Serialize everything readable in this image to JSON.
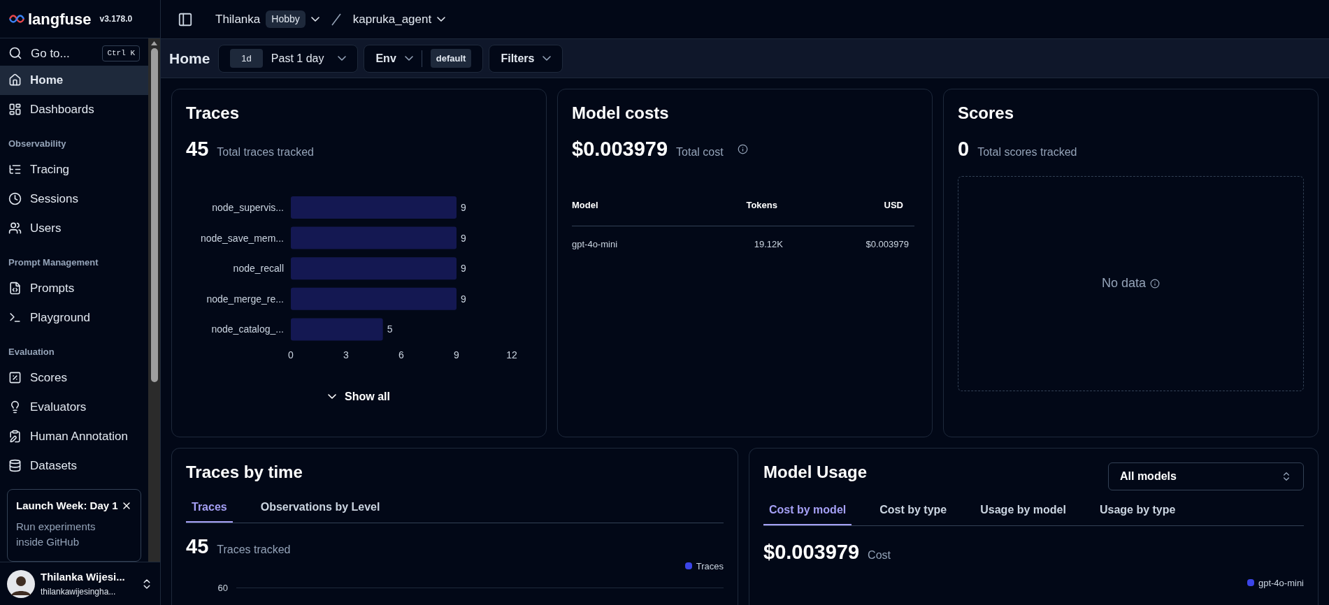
{
  "sidebar": {
    "brand": "langfuse",
    "version": "v3.178.0",
    "goto": {
      "label": "Go to...",
      "shortcut": "Ctrl K"
    },
    "sections": [
      {
        "items": [
          {
            "label": "Home",
            "selected": true
          },
          {
            "label": "Dashboards",
            "selected": false
          }
        ]
      },
      {
        "heading": "Observability",
        "items": [
          {
            "label": "Tracing",
            "selected": false
          },
          {
            "label": "Sessions",
            "selected": false
          },
          {
            "label": "Users",
            "selected": false
          }
        ]
      },
      {
        "heading": "Prompt Management",
        "items": [
          {
            "label": "Prompts",
            "selected": false
          },
          {
            "label": "Playground",
            "selected": false
          }
        ]
      },
      {
        "heading": "Evaluation",
        "items": [
          {
            "label": "Scores",
            "selected": false
          },
          {
            "label": "Evaluators",
            "selected": false
          },
          {
            "label": "Human Annotation",
            "selected": false
          },
          {
            "label": "Datasets",
            "selected": false
          }
        ]
      }
    ],
    "promo": {
      "title": "Launch Week: Day 1",
      "text": "Run experiments inside GitHub"
    },
    "user": {
      "name": "Thilanka Wijesi...",
      "email": "thilankawijesingha..."
    }
  },
  "topbar": {
    "org": "Thilanka",
    "plan": "Hobby",
    "project": "kapruka_agent"
  },
  "filterbar": {
    "title": "Home",
    "range_badge": "1d",
    "range": "Past 1 day",
    "env_label": "Env",
    "env_value": "default",
    "filters": "Filters"
  },
  "traces_card": {
    "title": "Traces",
    "total": "45",
    "total_label": "Total traces tracked",
    "show_all": "Show all",
    "chart_data": {
      "type": "bar",
      "orientation": "horizontal",
      "categories": [
        "node_supervis...",
        "node_save_mem...",
        "node_recall",
        "node_merge_re...",
        "node_catalog_..."
      ],
      "values": [
        9,
        9,
        9,
        9,
        5
      ],
      "xticks": [
        0,
        3,
        6,
        9,
        12
      ],
      "xlim": [
        0,
        12
      ],
      "data_labels": true
    }
  },
  "costs_card": {
    "title": "Model costs",
    "total": "$0.003979",
    "total_label": "Total cost",
    "columns": [
      "Model",
      "Tokens",
      "USD"
    ],
    "rows": [
      [
        "gpt-4o-mini",
        "19.12K",
        "$0.003979"
      ]
    ]
  },
  "scores_card": {
    "title": "Scores",
    "total": "0",
    "total_label": "Total scores tracked",
    "empty": "No data"
  },
  "time_card": {
    "title": "Traces by time",
    "tabs": [
      {
        "label": "Traces",
        "selected": true
      },
      {
        "label": "Observations by Level",
        "selected": false
      }
    ],
    "total": "45",
    "total_label": "Traces tracked",
    "legend": "Traces",
    "ytick": "60"
  },
  "usage_card": {
    "title": "Model Usage",
    "select": "All models",
    "tabs": [
      {
        "label": "Cost by model",
        "selected": true
      },
      {
        "label": "Cost by type",
        "selected": false
      },
      {
        "label": "Usage by model",
        "selected": false
      },
      {
        "label": "Usage by type",
        "selected": false
      }
    ],
    "total": "$0.003979",
    "total_label": "Cost",
    "legend": "gpt-4o-mini"
  }
}
